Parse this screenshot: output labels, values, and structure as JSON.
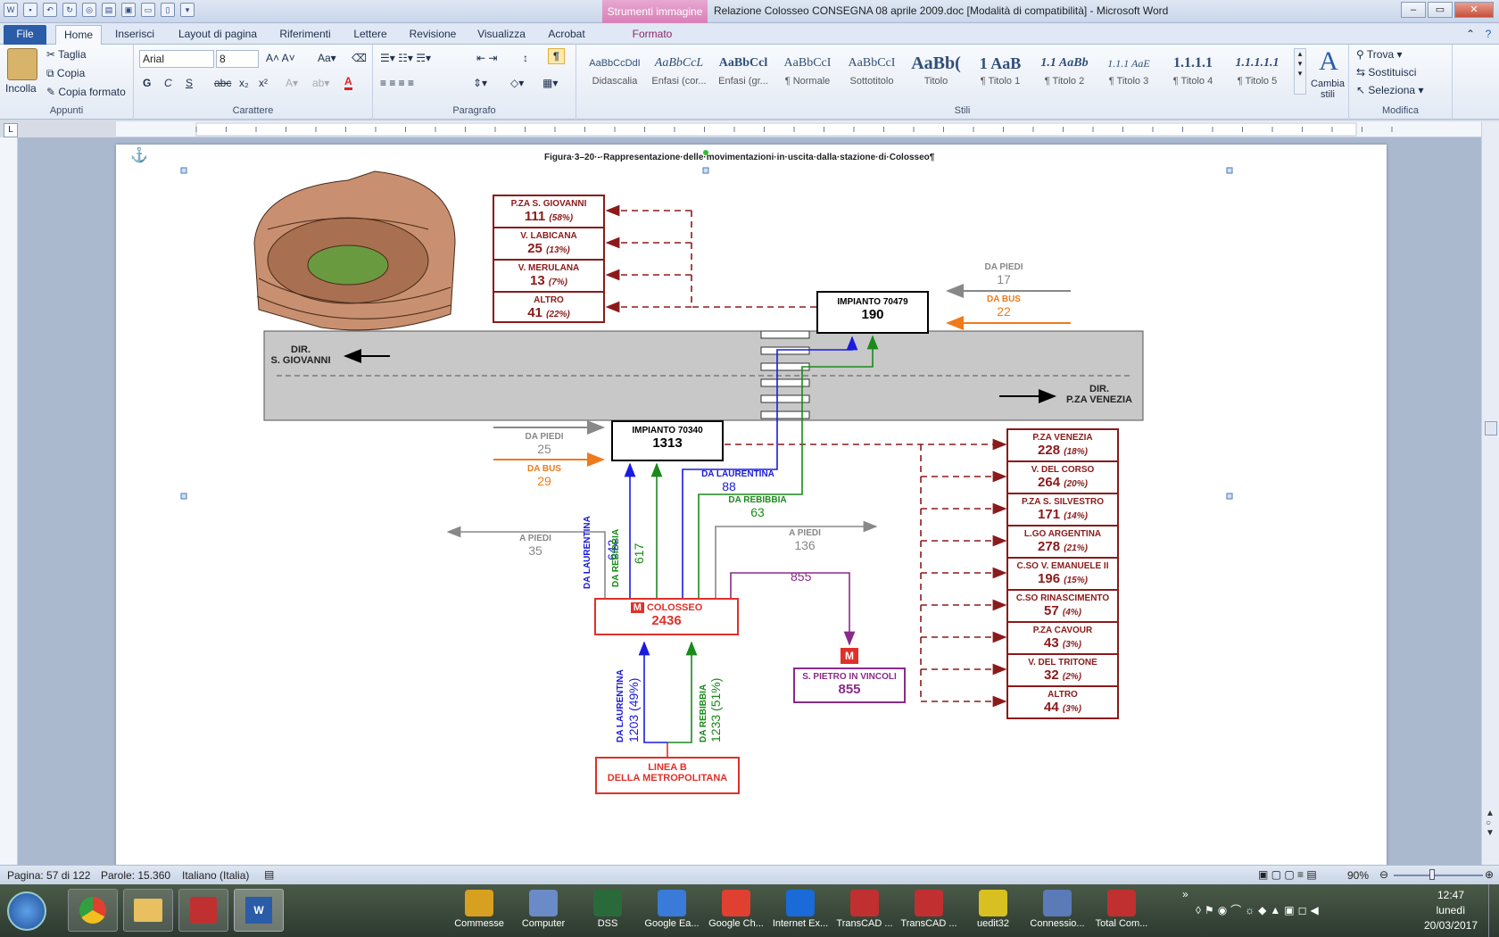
{
  "window": {
    "title": "Relazione Colosseo CONSEGNA 08 aprile 2009.doc [Modalità di compatibilità]  -  Microsoft Word",
    "context_tab": "Strumenti immagine",
    "controls": [
      "–",
      "▭",
      "✕"
    ]
  },
  "tabs": [
    {
      "label": "File"
    },
    {
      "label": "Home"
    },
    {
      "label": "Inserisci"
    },
    {
      "label": "Layout di pagina"
    },
    {
      "label": "Riferimenti"
    },
    {
      "label": "Lettere"
    },
    {
      "label": "Revisione"
    },
    {
      "label": "Visualizza"
    },
    {
      "label": "Acrobat"
    },
    {
      "label": "Formato"
    }
  ],
  "ribbon": {
    "clipboard": {
      "paste": "Incolla",
      "cut": "Taglia",
      "copy": "Copia",
      "format_painter": "Copia formato",
      "label": "Appunti"
    },
    "font": {
      "name": "Arial",
      "size": "8",
      "label": "Carattere",
      "bold": "G",
      "italic": "C",
      "underline": "S",
      "strike": "abc",
      "sub": "x₂",
      "sup": "x²"
    },
    "paragraph": {
      "label": "Paragrafo"
    },
    "styles": {
      "label": "Stili",
      "items": [
        {
          "preview": "AaBbCcDdI",
          "name": "Didascalia"
        },
        {
          "preview": "AaBbCcL",
          "name": "Enfasi (cor..."
        },
        {
          "preview": "AaBbCcl",
          "name": "Enfasi (gr..."
        },
        {
          "preview": "AaBbCcI",
          "name": "¶ Normale"
        },
        {
          "preview": "AaBbCcI",
          "name": "Sottotitolo"
        },
        {
          "preview": "AaBb(",
          "name": "Titolo"
        },
        {
          "preview": "1  AaB",
          "name": "¶ Titolo 1"
        },
        {
          "preview": "1.1  AaBb",
          "name": "¶ Titolo 2"
        },
        {
          "preview": "1.1.1  AaE",
          "name": "¶ Titolo 3"
        },
        {
          "preview": "1.1.1.1",
          "name": "¶ Titolo 4"
        },
        {
          "preview": "1.1.1.1.1",
          "name": "¶ Titolo 5"
        }
      ],
      "change": "Cambia stili"
    },
    "editing": {
      "find": "Trova",
      "replace": "Sostituisci",
      "select": "Seleziona",
      "label": "Modifica"
    }
  },
  "document": {
    "caption": "Figura·3–20·-·Rappresentazione·delle·movimentazioni·in·uscita·dalla·stazione·di·Colosseo¶",
    "destinations_top": [
      {
        "name": "P.ZA S. GIOVANNI",
        "value": "111",
        "pct": "(58%)"
      },
      {
        "name": "V. LABICANA",
        "value": "25",
        "pct": "(13%)"
      },
      {
        "name": "V. MERULANA",
        "value": "13",
        "pct": "(7%)"
      },
      {
        "name": "ALTRO",
        "value": "41",
        "pct": "(22%)"
      }
    ],
    "impianto_70479": {
      "title": "IMPIANTO  70479",
      "value": "190"
    },
    "da_piedi_top": {
      "label": "DA PIEDI",
      "value": "17"
    },
    "da_bus_top": {
      "label": "DA BUS",
      "value": "22"
    },
    "dir_sg": {
      "line1": "DIR.",
      "line2": "S. GIOVANNI"
    },
    "dir_pv": {
      "line1": "DIR.",
      "line2": "P.ZA VENEZIA"
    },
    "impianto_70340": {
      "title": "IMPIANTO 70340",
      "value": "1313"
    },
    "da_piedi_mid": {
      "label": "DA PIEDI",
      "value": "25"
    },
    "da_bus_mid": {
      "label": "DA BUS",
      "value": "29"
    },
    "da_laurentina_88": {
      "label": "DA LAURENTINA",
      "value": "88"
    },
    "da_rebibbia_63": {
      "label": "DA REBIBBIA",
      "value": "63"
    },
    "a_piedi_35": {
      "label": "A PIEDI",
      "value": "35"
    },
    "a_piedi_136": {
      "label": "A PIEDI",
      "value": "136"
    },
    "v642": {
      "label": "DA LAURENTINA",
      "value": "642"
    },
    "v617": {
      "label": "DA REBIBBIA",
      "value": "617"
    },
    "colosseo": {
      "title": "COLOSSEO",
      "value": "2436"
    },
    "flow855": "855",
    "spietro": {
      "title": "S. PIETRO IN VINCOLI",
      "value": "855"
    },
    "v1203": {
      "label": "DA LAURENTINA",
      "value": "1203 (49%)"
    },
    "v1233": {
      "label": "DA REBIBBIA",
      "value": "1233 (51%)"
    },
    "linea_b": {
      "line1": "LINEA B",
      "line2": "DELLA METROPOLITANA"
    },
    "metro_logo": "M",
    "destinations_right": [
      {
        "name": "P.ZA VENEZIA",
        "value": "228",
        "pct": "(18%)"
      },
      {
        "name": "V. DEL CORSO",
        "value": "264",
        "pct": "(20%)"
      },
      {
        "name": "P.ZA S. SILVESTRO",
        "value": "171",
        "pct": "(14%)"
      },
      {
        "name": "L.GO ARGENTINA",
        "value": "278",
        "pct": "(21%)"
      },
      {
        "name": "C.SO V. EMANUELE II",
        "value": "196",
        "pct": "(15%)"
      },
      {
        "name": "C.SO RINASCIMENTO",
        "value": "57",
        "pct": "(4%)"
      },
      {
        "name": "P.ZA CAVOUR",
        "value": "43",
        "pct": "(3%)"
      },
      {
        "name": "V. DEL TRITONE",
        "value": "32",
        "pct": "(2%)"
      },
      {
        "name": "ALTRO",
        "value": "44",
        "pct": "(3%)"
      }
    ]
  },
  "status": {
    "page": "Pagina: 57 di 122",
    "words": "Parole: 15.360",
    "lang": "Italiano (Italia)",
    "zoom": "90%"
  },
  "taskbar": {
    "items": [
      {
        "label": "Commesse"
      },
      {
        "label": "Computer"
      },
      {
        "label": "DSS"
      },
      {
        "label": "Google Ea..."
      },
      {
        "label": "Google Ch..."
      },
      {
        "label": "Internet Ex..."
      },
      {
        "label": "TransCAD ..."
      },
      {
        "label": "TransCAD ..."
      },
      {
        "label": "uedit32"
      },
      {
        "label": "Connessio..."
      },
      {
        "label": "Total Com..."
      }
    ],
    "time": "12:47",
    "day": "lunedì",
    "date": "20/03/2017"
  },
  "colors": {
    "darkred": "#8b1a1a",
    "red": "#e0302a",
    "blue": "#1a1ae0",
    "green": "#1a8a1a",
    "purple": "#8a2a8a",
    "orange": "#f07a1a",
    "gray": "#888888"
  }
}
